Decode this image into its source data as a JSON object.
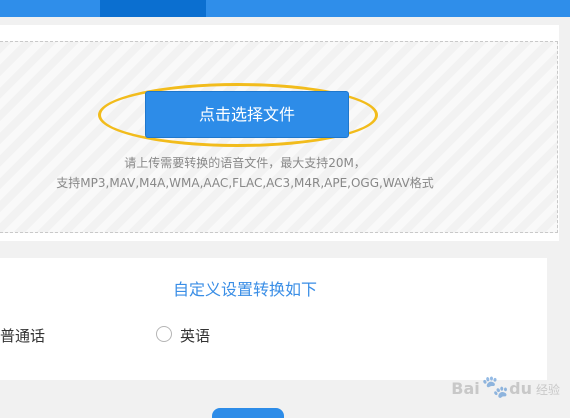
{
  "upload": {
    "button_label": "点击选择文件",
    "hint_line1": "请上传需要转换的语音文件，最大支持20M，",
    "hint_line2": "支持MP3,MAV,M4A,WMA,AAC,FLAC,AC3,M4R,APE,OGG,WAV格式"
  },
  "settings": {
    "title": "自定义设置转换如下",
    "option_mandarin": "普通话",
    "option_english": "英语"
  },
  "watermark": {
    "text_left": "Bai",
    "text_right": "du",
    "sub": "经验"
  },
  "colors": {
    "accent": "#2d8ce8",
    "highlight": "#f2bc1c",
    "title_blue": "#3a8ee6"
  }
}
